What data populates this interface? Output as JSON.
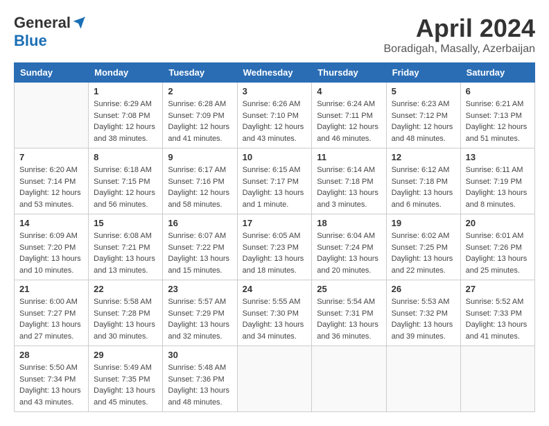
{
  "logo": {
    "general": "General",
    "blue": "Blue"
  },
  "title": "April 2024",
  "location": "Boradigah, Masally, Azerbaijan",
  "days_header": [
    "Sunday",
    "Monday",
    "Tuesday",
    "Wednesday",
    "Thursday",
    "Friday",
    "Saturday"
  ],
  "weeks": [
    [
      {
        "day": "",
        "info": ""
      },
      {
        "day": "1",
        "info": "Sunrise: 6:29 AM\nSunset: 7:08 PM\nDaylight: 12 hours\nand 38 minutes."
      },
      {
        "day": "2",
        "info": "Sunrise: 6:28 AM\nSunset: 7:09 PM\nDaylight: 12 hours\nand 41 minutes."
      },
      {
        "day": "3",
        "info": "Sunrise: 6:26 AM\nSunset: 7:10 PM\nDaylight: 12 hours\nand 43 minutes."
      },
      {
        "day": "4",
        "info": "Sunrise: 6:24 AM\nSunset: 7:11 PM\nDaylight: 12 hours\nand 46 minutes."
      },
      {
        "day": "5",
        "info": "Sunrise: 6:23 AM\nSunset: 7:12 PM\nDaylight: 12 hours\nand 48 minutes."
      },
      {
        "day": "6",
        "info": "Sunrise: 6:21 AM\nSunset: 7:13 PM\nDaylight: 12 hours\nand 51 minutes."
      }
    ],
    [
      {
        "day": "7",
        "info": "Sunrise: 6:20 AM\nSunset: 7:14 PM\nDaylight: 12 hours\nand 53 minutes."
      },
      {
        "day": "8",
        "info": "Sunrise: 6:18 AM\nSunset: 7:15 PM\nDaylight: 12 hours\nand 56 minutes."
      },
      {
        "day": "9",
        "info": "Sunrise: 6:17 AM\nSunset: 7:16 PM\nDaylight: 12 hours\nand 58 minutes."
      },
      {
        "day": "10",
        "info": "Sunrise: 6:15 AM\nSunset: 7:17 PM\nDaylight: 13 hours\nand 1 minute."
      },
      {
        "day": "11",
        "info": "Sunrise: 6:14 AM\nSunset: 7:18 PM\nDaylight: 13 hours\nand 3 minutes."
      },
      {
        "day": "12",
        "info": "Sunrise: 6:12 AM\nSunset: 7:18 PM\nDaylight: 13 hours\nand 6 minutes."
      },
      {
        "day": "13",
        "info": "Sunrise: 6:11 AM\nSunset: 7:19 PM\nDaylight: 13 hours\nand 8 minutes."
      }
    ],
    [
      {
        "day": "14",
        "info": "Sunrise: 6:09 AM\nSunset: 7:20 PM\nDaylight: 13 hours\nand 10 minutes."
      },
      {
        "day": "15",
        "info": "Sunrise: 6:08 AM\nSunset: 7:21 PM\nDaylight: 13 hours\nand 13 minutes."
      },
      {
        "day": "16",
        "info": "Sunrise: 6:07 AM\nSunset: 7:22 PM\nDaylight: 13 hours\nand 15 minutes."
      },
      {
        "day": "17",
        "info": "Sunrise: 6:05 AM\nSunset: 7:23 PM\nDaylight: 13 hours\nand 18 minutes."
      },
      {
        "day": "18",
        "info": "Sunrise: 6:04 AM\nSunset: 7:24 PM\nDaylight: 13 hours\nand 20 minutes."
      },
      {
        "day": "19",
        "info": "Sunrise: 6:02 AM\nSunset: 7:25 PM\nDaylight: 13 hours\nand 22 minutes."
      },
      {
        "day": "20",
        "info": "Sunrise: 6:01 AM\nSunset: 7:26 PM\nDaylight: 13 hours\nand 25 minutes."
      }
    ],
    [
      {
        "day": "21",
        "info": "Sunrise: 6:00 AM\nSunset: 7:27 PM\nDaylight: 13 hours\nand 27 minutes."
      },
      {
        "day": "22",
        "info": "Sunrise: 5:58 AM\nSunset: 7:28 PM\nDaylight: 13 hours\nand 30 minutes."
      },
      {
        "day": "23",
        "info": "Sunrise: 5:57 AM\nSunset: 7:29 PM\nDaylight: 13 hours\nand 32 minutes."
      },
      {
        "day": "24",
        "info": "Sunrise: 5:55 AM\nSunset: 7:30 PM\nDaylight: 13 hours\nand 34 minutes."
      },
      {
        "day": "25",
        "info": "Sunrise: 5:54 AM\nSunset: 7:31 PM\nDaylight: 13 hours\nand 36 minutes."
      },
      {
        "day": "26",
        "info": "Sunrise: 5:53 AM\nSunset: 7:32 PM\nDaylight: 13 hours\nand 39 minutes."
      },
      {
        "day": "27",
        "info": "Sunrise: 5:52 AM\nSunset: 7:33 PM\nDaylight: 13 hours\nand 41 minutes."
      }
    ],
    [
      {
        "day": "28",
        "info": "Sunrise: 5:50 AM\nSunset: 7:34 PM\nDaylight: 13 hours\nand 43 minutes."
      },
      {
        "day": "29",
        "info": "Sunrise: 5:49 AM\nSunset: 7:35 PM\nDaylight: 13 hours\nand 45 minutes."
      },
      {
        "day": "30",
        "info": "Sunrise: 5:48 AM\nSunset: 7:36 PM\nDaylight: 13 hours\nand 48 minutes."
      },
      {
        "day": "",
        "info": ""
      },
      {
        "day": "",
        "info": ""
      },
      {
        "day": "",
        "info": ""
      },
      {
        "day": "",
        "info": ""
      }
    ]
  ]
}
